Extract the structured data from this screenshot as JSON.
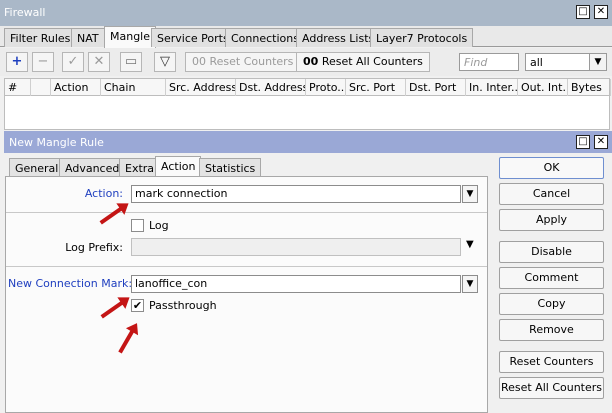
{
  "firewall": {
    "title": "Firewall",
    "tabs": [
      "Filter Rules",
      "NAT",
      "Mangle",
      "Service Ports",
      "Connections",
      "Address Lists",
      "Layer7 Protocols"
    ],
    "active_tab": "Mangle",
    "toolbar": {
      "reset_counters_label": "Reset Counters",
      "reset_all_counters_prefix": "00",
      "reset_all_counters_label": "Reset All Counters",
      "find_placeholder": "Find",
      "filter_value": "all"
    },
    "columns": [
      "#",
      "",
      "Action",
      "Chain",
      "Src. Address",
      "Dst. Address",
      "Proto...",
      "Src. Port",
      "Dst. Port",
      "In. Inter...",
      "Out. Int...",
      "Bytes"
    ]
  },
  "dialog": {
    "title": "New Mangle Rule",
    "tabs": [
      "General",
      "Advanced",
      "Extra",
      "Action",
      "Statistics"
    ],
    "active_tab": "Action",
    "action_label": "Action:",
    "action_value": "mark connection",
    "log_label": "Log",
    "log_checked": false,
    "log_prefix_label": "Log Prefix:",
    "new_connection_mark_label": "New Connection Mark:",
    "new_connection_mark_value": "lanoffice_con",
    "passthrough_label": "Passthrough",
    "passthrough_checked": true,
    "buttons": [
      "OK",
      "Cancel",
      "Apply",
      "Disable",
      "Comment",
      "Copy",
      "Remove",
      "Reset Counters",
      "Reset All Counters"
    ]
  },
  "colors": {
    "annotation_arrow": "#c41515",
    "dialog_title_bar": "#9aa8d6",
    "blue_label": "#1f3fbf"
  }
}
